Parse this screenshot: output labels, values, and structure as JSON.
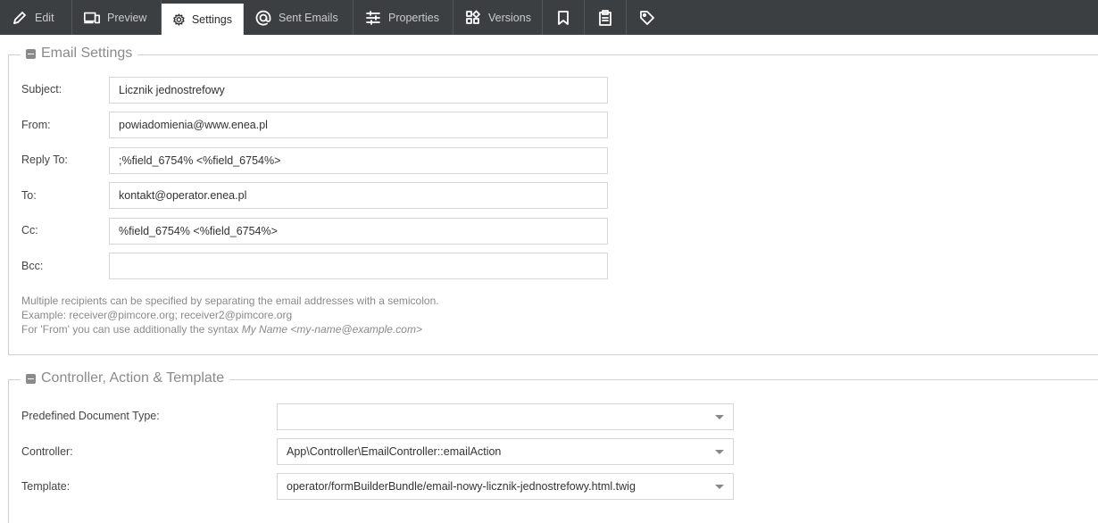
{
  "tabs": [
    {
      "label": "Edit",
      "icon": "pencil-icon"
    },
    {
      "label": "Preview",
      "icon": "devices-icon"
    },
    {
      "label": "Settings",
      "icon": "gear-icon",
      "active": true
    },
    {
      "label": "Sent Emails",
      "icon": "at-sign-icon"
    },
    {
      "label": "Properties",
      "icon": "sliders-icon"
    },
    {
      "label": "Versions",
      "icon": "blocks-icon"
    },
    {
      "label": "",
      "icon": "bookmark-icon"
    },
    {
      "label": "",
      "icon": "clipboard-icon"
    },
    {
      "label": "",
      "icon": "tag-icon"
    }
  ],
  "email_settings": {
    "title": "Email Settings",
    "subject": {
      "label": "Subject:",
      "value": "Licznik jednostrefowy"
    },
    "from": {
      "label": "From:",
      "value": "powiadomienia@www.enea.pl"
    },
    "reply_to": {
      "label": "Reply To:",
      "value": ";%field_6754%  <%field_6754%>"
    },
    "to": {
      "label": "To:",
      "value": "kontakt@operator.enea.pl"
    },
    "cc": {
      "label": "Cc:",
      "value": "%field_6754%  <%field_6754%>"
    },
    "bcc": {
      "label": "Bcc:",
      "value": ""
    },
    "help_line1": "Multiple recipients can be specified by separating the email addresses with a semicolon.",
    "help_line2": "Example: receiver@pimcore.org; receiver2@pimcore.org",
    "help_line3_prefix": "For 'From' you can use additionally the syntax ",
    "help_line3_syntax": "My Name <my-name@example.com>"
  },
  "controller_section": {
    "title": "Controller, Action & Template",
    "doc_type": {
      "label": "Predefined Document Type:",
      "value": ""
    },
    "controller": {
      "label": "Controller:",
      "value": "App\\Controller\\EmailController::emailAction"
    },
    "template": {
      "label": "Template:",
      "value": "operator/formBuilderBundle/email-nowy-licznik-jednostrefowy.html.twig"
    }
  },
  "colors": {
    "toolbar_bg": "#3c3f41",
    "accent": "#ffffff"
  }
}
